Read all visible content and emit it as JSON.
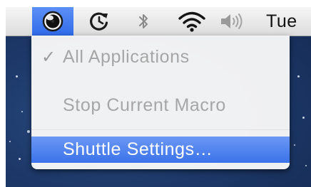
{
  "menubar": {
    "items": [
      {
        "icon": "shuttle-knob-icon",
        "selected": true
      },
      {
        "icon": "time-machine-clock-icon"
      },
      {
        "icon": "bluetooth-icon"
      },
      {
        "icon": "wifi-icon"
      },
      {
        "icon": "volume-icon"
      }
    ],
    "day": "Tue",
    "highlight_color": "#3a74ec"
  },
  "menu": {
    "items": [
      {
        "label": "All Applications",
        "checked": true,
        "check_mark": "✓",
        "enabled": false
      },
      {
        "label": "Stop Current Macro",
        "enabled": false
      },
      {
        "label": "Shuttle Settings…",
        "enabled": true,
        "highlighted": true
      }
    ]
  }
}
